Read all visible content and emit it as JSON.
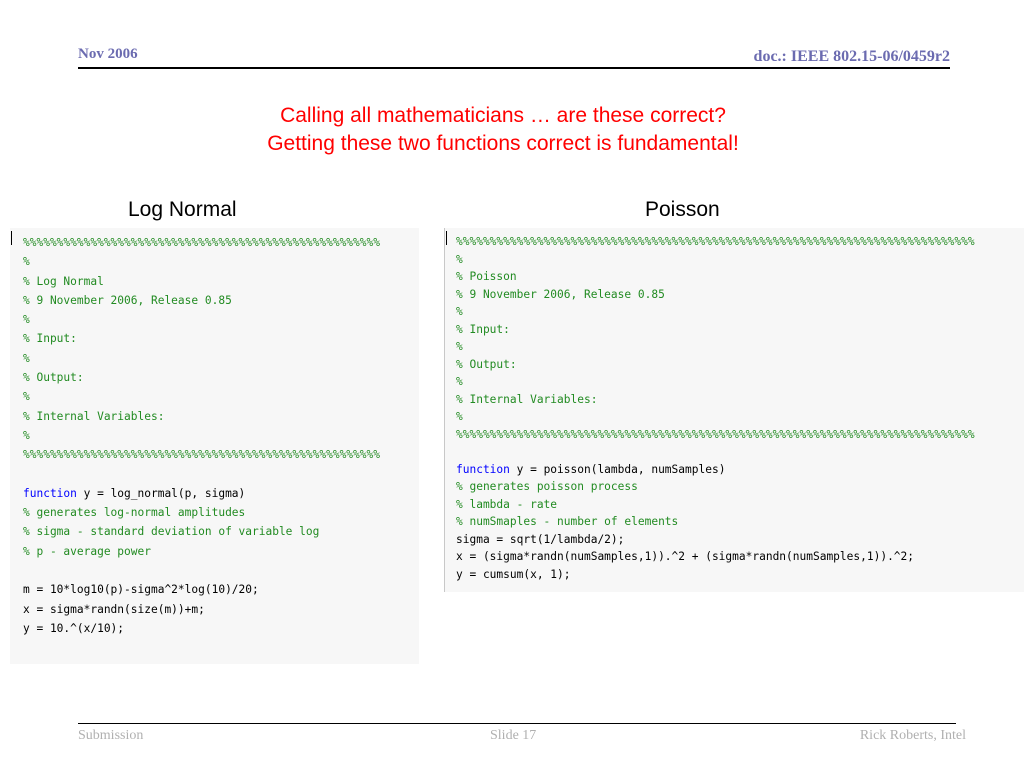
{
  "header": {
    "date": "Nov 2006",
    "doc": "doc.: IEEE 802.15-06/0459r2"
  },
  "title": {
    "line1": "Calling all mathematicians … are these correct?",
    "line2": "Getting these two functions correct is fundamental!"
  },
  "columns": {
    "left": "Log Normal",
    "right": "Poisson"
  },
  "code_left": [
    "%%%%%%%%%%%%%%%%%%%%%%%%%%%%%%%%%%%%%%%%%%%%%%%%%%%%%",
    "%",
    "% Log Normal",
    "% 9 November 2006, Release 0.85",
    "%",
    "% Input:",
    "%",
    "% Output:",
    "%",
    "% Internal Variables:",
    "%",
    "%%%%%%%%%%%%%%%%%%%%%%%%%%%%%%%%%%%%%%%%%%%%%%%%%%%%%",
    "",
    "function",
    " y = log_normal(p, sigma)",
    "% generates log-normal amplitudes",
    "% sigma - standard deviation of variable log",
    "% p - average power",
    "",
    "m = 10*log10(p)-sigma^2*log(10)/20;",
    "x = sigma*randn(size(m))+m;",
    "y = 10.^(x/10);"
  ],
  "code_right": [
    "%%%%%%%%%%%%%%%%%%%%%%%%%%%%%%%%%%%%%%%%%%%%%%%%%%%%%%%%%%%%%%%%%%%%%%%%%%%%%",
    "%",
    "% Poisson",
    "% 9 November 2006, Release 0.85",
    "%",
    "% Input:",
    "%",
    "% Output:",
    "%",
    "% Internal Variables:",
    "%",
    "%%%%%%%%%%%%%%%%%%%%%%%%%%%%%%%%%%%%%%%%%%%%%%%%%%%%%%%%%%%%%%%%%%%%%%%%%%%%%",
    "",
    "function",
    " y = poisson(lambda, numSamples)",
    "% generates poisson process",
    "% lambda - rate",
    "% numSmaples - number of elements",
    "sigma = sqrt(1/lambda/2);",
    "x = (sigma*randn(numSamples,1)).^2 + (sigma*randn(numSamples,1)).^2;",
    "y = cumsum(x, 1);"
  ],
  "footer": {
    "left": "Submission",
    "mid": "Slide 17",
    "right": "Rick Roberts, Intel"
  },
  "colors": {
    "title": "#ff0000",
    "comment": "#228b22",
    "keyword": "#0000ff",
    "header": "#6b6bb0",
    "footer": "#b0b0b0"
  }
}
